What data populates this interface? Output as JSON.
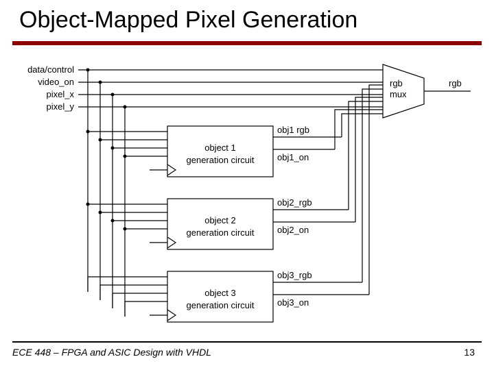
{
  "title": "Object-Mapped Pixel Generation",
  "footer": "ECE 448 – FPGA and ASIC Design with VHDL",
  "page": "13",
  "inputs": {
    "i0": "data/control",
    "i1": "video_on",
    "i2": "pixel_x",
    "i3": "pixel_y"
  },
  "boxes": {
    "obj1": {
      "l1": "object 1",
      "l2": "generation circuit"
    },
    "obj2": {
      "l1": "object 2",
      "l2": "generation circuit"
    },
    "obj3": {
      "l1": "object 3",
      "l2": "generation circuit"
    }
  },
  "outs": {
    "o1a": "obj1 rgb",
    "o1b": "obj1_on",
    "o2a": "obj2_rgb",
    "o2b": "obj2_on",
    "o3a": "obj3_rgb",
    "o3b": "obj3_on"
  },
  "mux": {
    "l1": "rgb",
    "l2": "mux"
  },
  "final": "rgb"
}
